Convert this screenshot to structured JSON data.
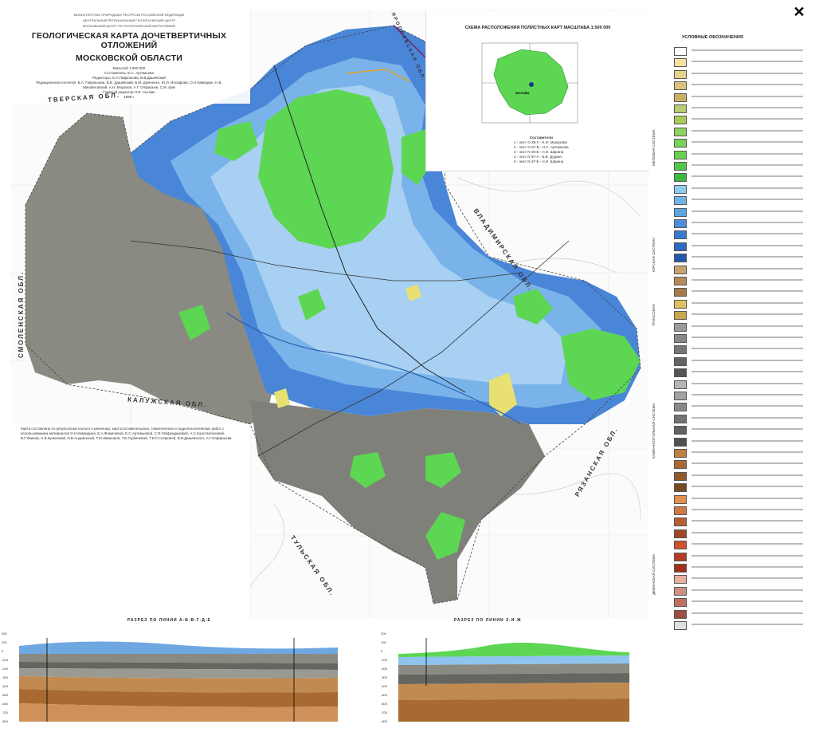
{
  "title_block": {
    "ministry": "МИНИСТЕРСТВО ПРИРОДНЫХ РЕСУРСОВ РОССИЙСКОЙ ФЕДЕРАЦИИ",
    "center": "ЦЕНТРАЛЬНЫЙ РЕГИОНАЛЬНЫЙ ГЕОЛОГИЧЕСКИЙ ЦЕНТР",
    "center2": "МОСКОВСКИЙ ЦЕНТР ПО ГЕОЛОГИЧЕСКОЙ КАРТОГРАФИИ",
    "title_line1": "ГЕОЛОГИЧЕСКАЯ КАРТА ДОЧЕТВЕРТИЧНЫХ ОТЛОЖЕНИЙ",
    "title_line2": "МОСКОВСКОЙ ОБЛАСТИ",
    "scale": "Масштаб 1:500 000",
    "compiler": "Составитель: Б.С. Артемьева",
    "editors": "Редакторы: Е.А.Гаврюшова, В.В.Дашевский",
    "board1": "Редакционная коллегия: Б.А. Гаврюшова, В.В. Дашевский, Б.М. Демченко, Ю.И. Иосифова, О.Н.Кавердин, Н.В.",
    "board2": "Михайловский, А.Н. Морозов, А.Г. Олферьев, С.М. Шик",
    "chief": "Главный редактор Н.И. Сычкин",
    "year": "1998 г."
  },
  "inset": {
    "title": "СХЕМА РАСПОЛОЖЕНИЯ ПОЛИСТНЫХ КАРТ МАСШТАБА 1:500 000",
    "center_label": "МОСКВА",
    "compilers_head": "Составители",
    "compilers": [
      "1 - лист О-36-Г - Н.И. Мишукова",
      "2 - лист О-37-В - Н.С. Артемьева",
      "3 - лист N-36-Б - Н.И. Ширина",
      "4 - лист N-37-А - Б.В. Дудкин",
      "5 - лист N-37-Б - Н.И. Ширина"
    ]
  },
  "regions": {
    "tver": "ТВЕРСКАЯ ОБЛ.",
    "smolensk": "СМОЛЕНСКАЯ ОБЛ.",
    "kaluga": "КАЛУЖСКАЯ ОБЛ.",
    "vladimir": "ВЛАДИМИРСКАЯ ОБЛ.",
    "tula": "ТУЛЬСКАЯ ОБЛ.",
    "ryazan": "РЯЗАНСКАЯ ОБЛ.",
    "yaroslavl": "ЯРОСЛАВСКАЯ ОБЛ."
  },
  "note": "Карта составлена по результатам геолого-съемочных, картосоставительских, тематических и гидрогеологических работ с использованием материалов О.Н.Кавердина, Е.А.Фомичевой, Е.С.Артемьевой, С.Ф.Гайфундиновой, А.С.Константиновой, В.Г.Якиной, Н.Б.Кучиновой, И.В.Андиянской, Т.Ю.Ивановой, Т.Е.Горбачевой, Т.И.Столяровой, В.В.Дашевского, А.Г.Олферьева",
  "legend": {
    "title": "УСЛОВНЫЕ ОБОЗНАЧЕНИЯ",
    "items": [
      {
        "color": "#ffffff"
      },
      {
        "color": "#f4e3a0"
      },
      {
        "color": "#e6d38a"
      },
      {
        "color": "#dcc27a"
      },
      {
        "color": "#c8b060"
      },
      {
        "color": "#b8cc70"
      },
      {
        "color": "#a6cc5a"
      },
      {
        "color": "#8fd45e"
      },
      {
        "color": "#7ad35a"
      },
      {
        "color": "#66d24f"
      },
      {
        "color": "#4fc84a"
      },
      {
        "color": "#3cb940"
      },
      {
        "color": "#8ecbee"
      },
      {
        "color": "#6cb6ea"
      },
      {
        "color": "#5aa5e4"
      },
      {
        "color": "#4a8fdc"
      },
      {
        "color": "#3a7ad0"
      },
      {
        "color": "#2f68c2"
      },
      {
        "color": "#2458b0"
      },
      {
        "color": "#c9a070"
      },
      {
        "color": "#b88a5a"
      },
      {
        "color": "#a67a4a"
      },
      {
        "color": "#e0c060"
      },
      {
        "color": "#c8a848"
      },
      {
        "color": "#9b9b9b"
      },
      {
        "color": "#888888"
      },
      {
        "color": "#767676"
      },
      {
        "color": "#646464"
      },
      {
        "color": "#555555"
      },
      {
        "color": "#b5b5b5"
      },
      {
        "color": "#a2a2a2"
      },
      {
        "color": "#8a8a8a"
      },
      {
        "color": "#737373"
      },
      {
        "color": "#606060"
      },
      {
        "color": "#505050"
      },
      {
        "color": "#c08040"
      },
      {
        "color": "#a86a30"
      },
      {
        "color": "#905a28"
      },
      {
        "color": "#784a20"
      },
      {
        "color": "#e09050"
      },
      {
        "color": "#d07840"
      },
      {
        "color": "#b86030"
      },
      {
        "color": "#a04828"
      },
      {
        "color": "#d05030"
      },
      {
        "color": "#b83c24"
      },
      {
        "color": "#a0301c"
      },
      {
        "color": "#e8b0a0"
      },
      {
        "color": "#d09080"
      },
      {
        "color": "#c07060"
      },
      {
        "color": "#9a5040"
      },
      {
        "color": "#e0e0e0"
      }
    ],
    "systems": [
      {
        "label": "МЕЛОВАЯ СИСТЕМА"
      },
      {
        "label": "ЮРСКАЯ СИСТЕМА"
      },
      {
        "label": "ТРИАСОВАЯ"
      },
      {
        "label": "КАМЕННОУГОЛЬНАЯ СИСТЕМА"
      },
      {
        "label": "ДЕВОНСКАЯ СИСТЕМА"
      }
    ]
  },
  "sections": {
    "left_title": "РАЗРЕЗ ПО ЛИНИИ А-Б-В-Г-Д-Е",
    "right_title": "РАЗРЕЗ ПО ЛИНИИ З-И-Ж",
    "depth_ticks": [
      "200",
      "100",
      "0",
      "-100",
      "-200",
      "-300",
      "-400",
      "-500",
      "-600",
      "-700",
      "-800"
    ]
  },
  "colors": {
    "blue_dark": "#3f7fd6",
    "blue_light": "#8ec4ee",
    "green": "#5dd653",
    "grey": "#8a8a82",
    "yellow": "#e8e070"
  },
  "close_label": "✕"
}
